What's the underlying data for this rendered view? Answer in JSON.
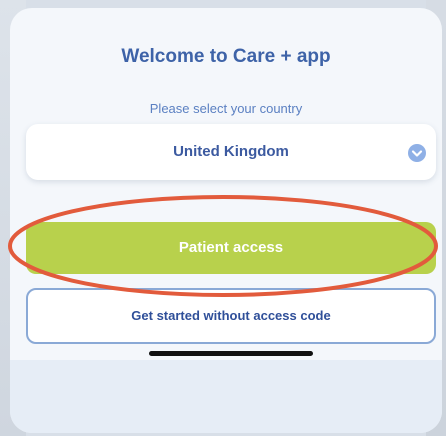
{
  "header": {
    "title": "Welcome to Care + app",
    "subtitle": "Please select your country"
  },
  "country_select": {
    "value": "United Kingdom",
    "icon": "chevron-down-icon"
  },
  "buttons": {
    "patient_access": "Patient access",
    "no_code": "Get started without access code"
  },
  "colors": {
    "title": "#3e63a8",
    "accent_green": "#b8d14c",
    "highlight": "#e25b3c",
    "outline_blue": "#8aa9d6"
  }
}
